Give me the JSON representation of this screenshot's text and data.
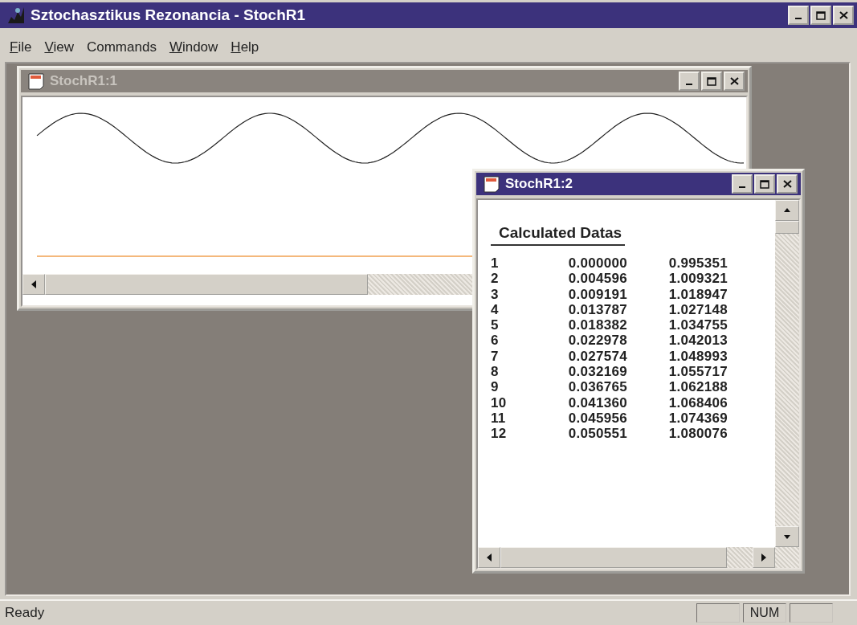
{
  "window": {
    "title": "Sztochasztikus Rezonancia - StochR1"
  },
  "menu": [
    {
      "key": "F",
      "rest": "ile"
    },
    {
      "key": "V",
      "rest": "iew"
    },
    {
      "rest": "Commands"
    },
    {
      "key": "W",
      "rest": "indow"
    },
    {
      "key": "H",
      "rest": "elp"
    }
  ],
  "children": [
    {
      "title": "StochR1:1",
      "active": false,
      "kind": "plot"
    },
    {
      "title": "StochR1:2",
      "active": true,
      "kind": "table",
      "heading": "Calculated Datas",
      "rows": [
        [
          "1",
          "0.000000",
          "0.995351"
        ],
        [
          "2",
          "0.004596",
          "1.009321"
        ],
        [
          "3",
          "0.009191",
          "1.018947"
        ],
        [
          "4",
          "0.013787",
          "1.027148"
        ],
        [
          "5",
          "0.018382",
          "1.034755"
        ],
        [
          "6",
          "0.022978",
          "1.042013"
        ],
        [
          "7",
          "0.027574",
          "1.048993"
        ],
        [
          "8",
          "0.032169",
          "1.055717"
        ],
        [
          "9",
          "0.036765",
          "1.062188"
        ],
        [
          "10",
          "0.041360",
          "1.068406"
        ],
        [
          "11",
          "0.045956",
          "1.074369"
        ],
        [
          "12",
          "0.050551",
          "1.080076"
        ]
      ]
    }
  ],
  "status_bar": {
    "text": "Ready",
    "indicators": [
      "NUM"
    ]
  }
}
